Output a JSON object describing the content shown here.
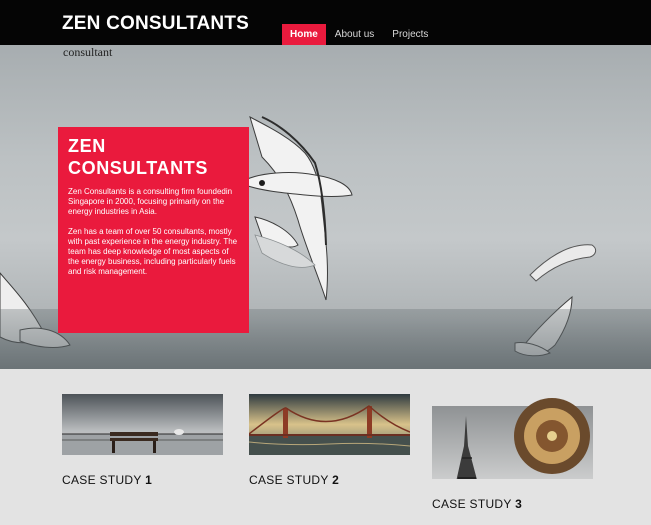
{
  "header": {
    "title": "ZEN CONSULTANTS",
    "subtitle": "consultant",
    "nav": [
      {
        "label": "Home",
        "active": true
      },
      {
        "label": "About us",
        "active": false
      },
      {
        "label": "Projects",
        "active": false
      }
    ]
  },
  "hero": {
    "promo_title_line1": "ZEN",
    "promo_title_line2": "CONSULTANTS",
    "paragraph1": "Zen Consultants is a consulting firm foundedin Singapore in 2000, focusing primarily on the energy industries in Asia.",
    "paragraph2": "Zen has a team of over 50 consultants, mostly with past experience in the energy industry. The team has deep knowledge of most aspects of the energy business, including particularly fuels and risk management."
  },
  "cases": [
    {
      "title": "CASE STUDY",
      "number": "1"
    },
    {
      "title": "CASE STUDY",
      "number": "2"
    },
    {
      "title": "CASE STUDY",
      "number": "3"
    }
  ],
  "colors": {
    "accent": "#ea1a3d",
    "header_bg": "#050505",
    "section_bg": "#e3e3e3"
  }
}
